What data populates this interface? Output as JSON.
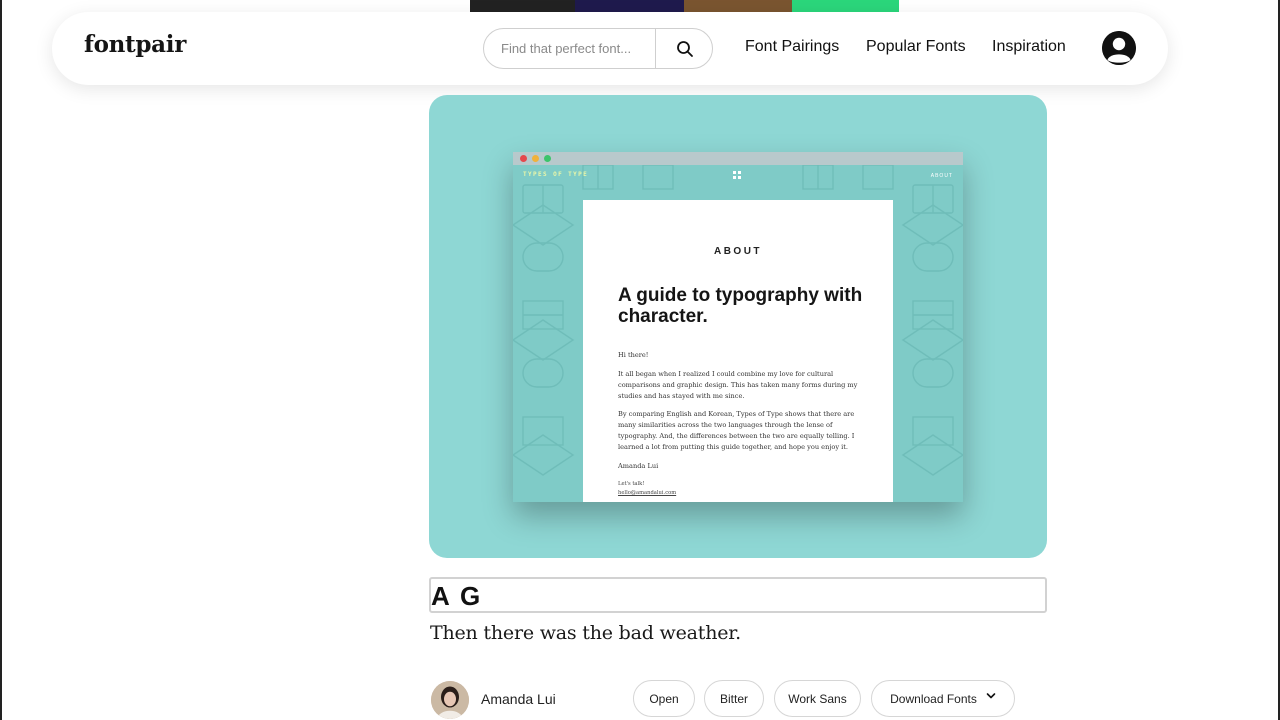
{
  "colors": {
    "hero_bg": "#8ed7d4",
    "strip": [
      "#222222",
      "#1f1a4d",
      "#7a5530",
      "#2bd67b"
    ]
  },
  "navbar": {
    "logo": "fontpair",
    "search": {
      "placeholder": "Find that perfect font...",
      "icon": "search-icon"
    },
    "links": [
      "Font Pairings",
      "Popular Fonts",
      "Inspiration"
    ],
    "account_icon": "user-icon"
  },
  "hero": {
    "mock_site": {
      "site_title": "TYPES OF TYPE",
      "about_link": "ABOUT",
      "page": {
        "label": "ABOUT",
        "heading": "A guide to typography with character.",
        "greeting": "Hi there!",
        "paragraph1": "It all began when I realized I could combine my love for cultural comparisons and graphic design. This has taken many forms during my studies and has stayed with me since.",
        "paragraph2": "By comparing English and Korean, Types of Type shows that there are many similarities across the two languages through the lense of typography. And, the differences between the two are equally telling. I learned a lot from putting this guide together, and hope you enjoy it.",
        "signature": "Amanda Lui",
        "contact_label": "Let's talk!",
        "contact_email": "hello@amandalui.com"
      }
    }
  },
  "sample": {
    "heading_text": "A G",
    "body_text": "Then there was the bad weather."
  },
  "footer": {
    "author": "Amanda Lui",
    "chips": [
      "Open",
      "Bitter",
      "Work Sans"
    ],
    "download_label": "Download Fonts"
  }
}
